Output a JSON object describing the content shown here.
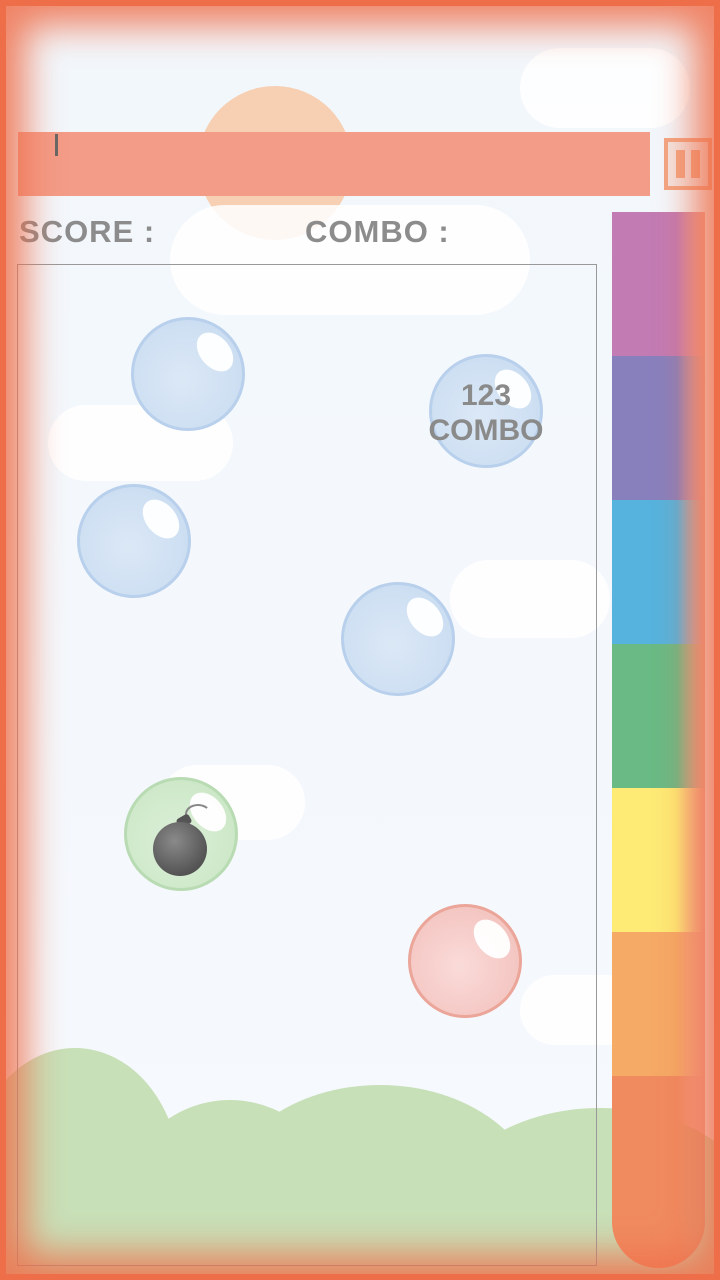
{
  "hud": {
    "score_label": "SCORE :",
    "combo_label": "COMBO :"
  },
  "bubbles": [
    {
      "name": "bubble-blue-1",
      "color": "blue",
      "text": ""
    },
    {
      "name": "bubble-blue-combo",
      "color": "blue",
      "text_line1": "123",
      "text_line2": "COMBO"
    },
    {
      "name": "bubble-blue-2",
      "color": "blue",
      "text": ""
    },
    {
      "name": "bubble-blue-3",
      "color": "blue",
      "text": ""
    },
    {
      "name": "bubble-bomb",
      "color": "green",
      "icon": "bomb-icon"
    },
    {
      "name": "bubble-red",
      "color": "red",
      "text": ""
    }
  ],
  "color_tube": {
    "segments": [
      "#c27bb3",
      "#8880bd",
      "#56b3dd",
      "#69ba85",
      "#fdeb75",
      "#f5aa66",
      "#f08b60"
    ]
  }
}
